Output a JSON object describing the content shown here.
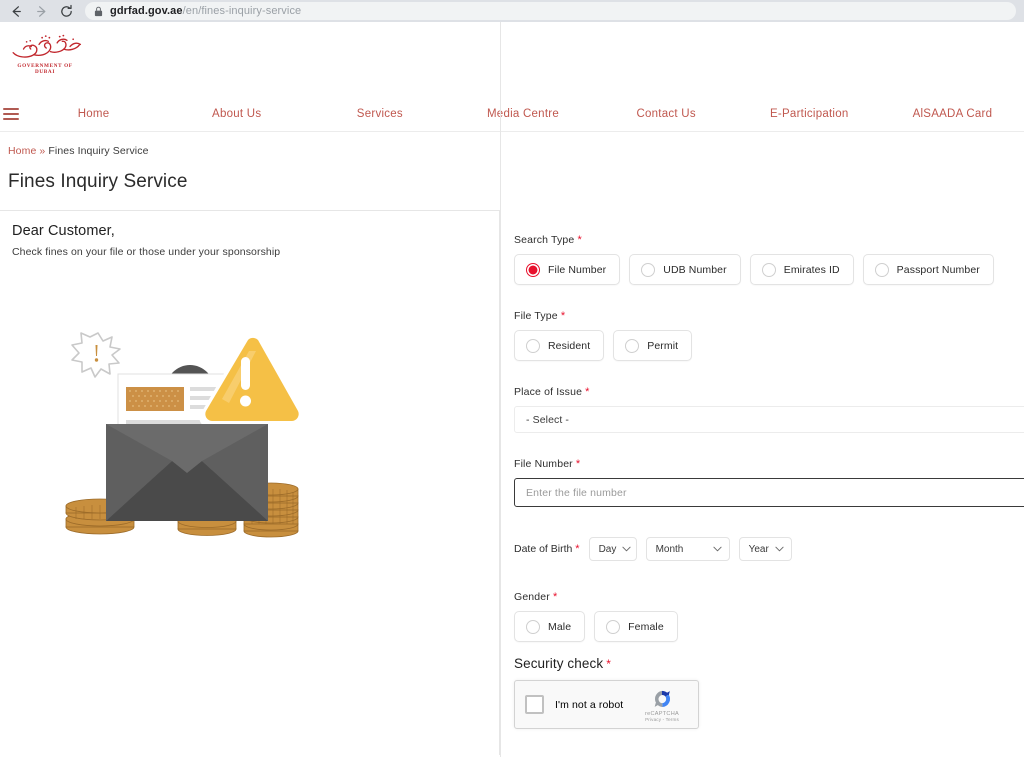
{
  "browser": {
    "back_icon": "back-arrow-icon",
    "forward_icon": "forward-arrow-icon",
    "reload_icon": "reload-icon",
    "lock_icon": "lock-icon",
    "url_host": "gdrfad.gov.ae",
    "url_path": "/en/fines-inquiry-service"
  },
  "header": {
    "logo_caption": "GOVERNMENT OF DUBAI",
    "logo_name": "government-of-dubai-logo",
    "menu_icon": "hamburger-menu-icon"
  },
  "nav": {
    "items": [
      {
        "label": "Home"
      },
      {
        "label": "About Us"
      },
      {
        "label": "Services"
      },
      {
        "label": "Media Centre"
      },
      {
        "label": "Contact Us"
      },
      {
        "label": "E-Participation"
      },
      {
        "label": "AlSAADA Card"
      }
    ]
  },
  "breadcrumb": {
    "home": "Home",
    "separator": "»",
    "current": "Fines Inquiry Service"
  },
  "page": {
    "title": "Fines Inquiry Service"
  },
  "left_panel": {
    "greeting": "Dear Customer,",
    "description": "Check fines on your file or those under your sponsorship",
    "illustration_name": "fines-envelope-illustration"
  },
  "form": {
    "required_marker": "*",
    "search_type": {
      "label": "Search Type",
      "options": [
        {
          "label": "File Number",
          "selected": true
        },
        {
          "label": "UDB Number",
          "selected": false
        },
        {
          "label": "Emirates ID",
          "selected": false
        },
        {
          "label": "Passport Number",
          "selected": false
        }
      ]
    },
    "file_type": {
      "label": "File Type",
      "options": [
        {
          "label": "Resident",
          "selected": false
        },
        {
          "label": "Permit",
          "selected": false
        }
      ]
    },
    "place_of_issue": {
      "label": "Place of Issue",
      "value": "- Select -"
    },
    "file_number": {
      "label": "File Number",
      "value": "",
      "placeholder": "Enter the file number"
    },
    "date_of_birth": {
      "label": "Date of Birth",
      "day": "Day",
      "month": "Month",
      "year": "Year"
    },
    "gender": {
      "label": "Gender",
      "options": [
        {
          "label": "Male",
          "selected": false
        },
        {
          "label": "Female",
          "selected": false
        }
      ]
    },
    "security": {
      "title": "Security check",
      "recaptcha_label": "I'm not a robot",
      "recaptcha_brand": "reCAPTCHA",
      "recaptcha_legal": "Privacy - Terms",
      "recaptcha_logo_name": "recaptcha-logo-icon"
    }
  },
  "colors": {
    "brand_red": "#c0584f",
    "accent_red": "#e8112d",
    "logo_red": "#c1272d",
    "warning_yellow": "#f5c046",
    "coin_gold": "#c88f3e"
  }
}
